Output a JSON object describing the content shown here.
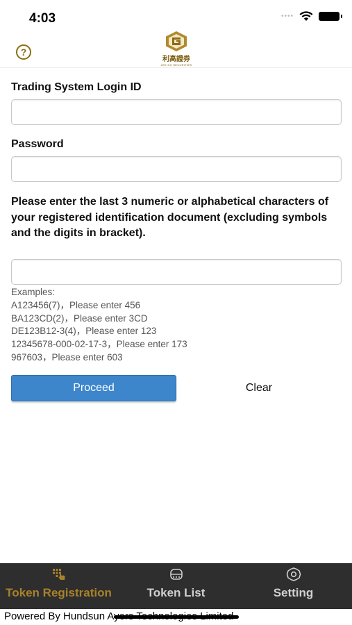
{
  "status_bar": {
    "time": "4:03"
  },
  "header": {
    "help_icon": "help-circle-icon",
    "logo": {
      "name": "利高證券",
      "sub": "LEE KO SECURITIES"
    }
  },
  "form": {
    "login_id_label": "Trading System Login ID",
    "login_id_value": "",
    "password_label": "Password",
    "password_value": "",
    "instructions": "Please enter the last 3 numeric or alphabetical characters of your registered identification document (excluding symbols and the digits in bracket).",
    "id_value": "",
    "examples_title": "Examples:",
    "examples": [
      "A123456(7)，Please enter 456",
      "BA123CD(2)，Please enter 3CD",
      "DE123B12-3(4)，Please enter 123",
      "12345678-000-02-17-3，Please enter 173",
      "967603，Please enter 603"
    ],
    "proceed_label": "Proceed",
    "clear_label": "Clear"
  },
  "tabs": [
    {
      "label": "Token Registration",
      "icon": "keypad-hand-icon",
      "active": true
    },
    {
      "label": "Token List",
      "icon": "token-device-icon",
      "active": false
    },
    {
      "label": "Setting",
      "icon": "gear-icon",
      "active": false
    }
  ],
  "footer": "Powered By Hundsun Ayers Technologies Limited",
  "colors": {
    "accent": "#3d86cc",
    "brand_gold": "#a8822a",
    "tab_bar": "#2e2e2e"
  }
}
